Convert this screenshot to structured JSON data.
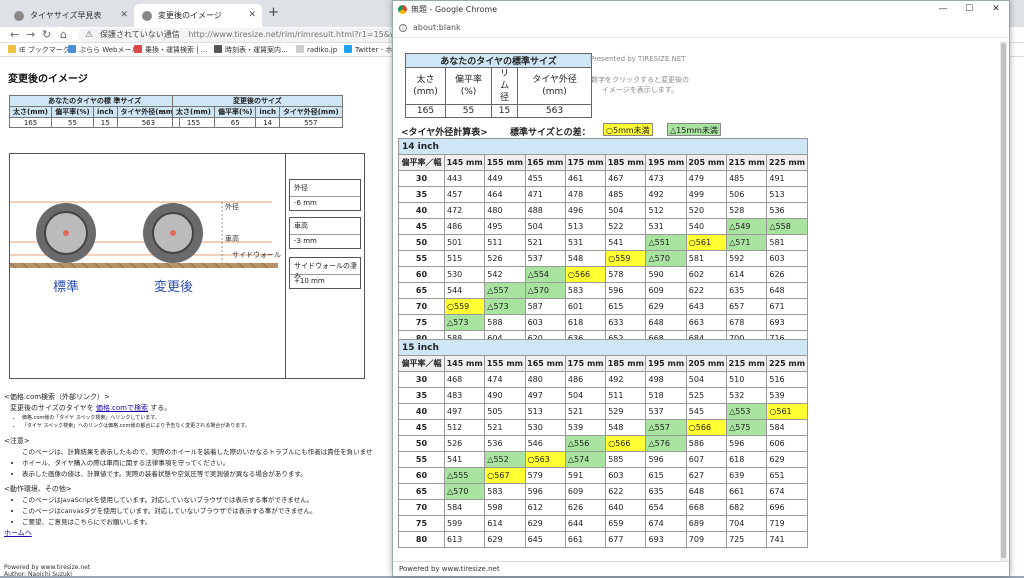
{
  "bg": {
    "tabs": [
      {
        "label": "タイヤサイズ早見表"
      },
      {
        "label": "変更後のイメージ"
      }
    ],
    "security_warning": "保護されていない通信",
    "url": "http://www.tiresize.net/rim/rimresult.html?r1=15&w1=165&f1=558",
    "bookmarks": [
      "IE ブックマーク",
      "ぷらら Webメール",
      "乗換・運賃検索 | ...",
      "時刻表・運賃案内...",
      "radiko.jp",
      "Twitter - ホーム"
    ],
    "page_title": "変更後のイメージ",
    "std_caption": "あなたのタイヤの標 準サイズ",
    "chg_caption": "変更後のサイズ",
    "small_headers": [
      "太さ(mm)",
      "偏平率(%)",
      "inch",
      "タイヤ外径(mm)"
    ],
    "std_values": [
      "165",
      "55",
      "15",
      "563"
    ],
    "chg_values": [
      "155",
      "65",
      "14",
      "557"
    ],
    "arrow": "⇒",
    "diagram": {
      "outer_label": "外径",
      "height_label": "車高",
      "sidewall_label": "サイドウォール",
      "std_name": "標準",
      "chg_name": "変更後",
      "boxes": [
        {
          "k": "外径",
          "v": "-6 mm"
        },
        {
          "k": "車高",
          "v": "-3 mm"
        },
        {
          "k": "サイドウォールの凄み",
          "v": "+10 mm"
        }
      ]
    },
    "kakaku_head": "<価格.com検索（外部リンク）>",
    "kakaku_line_pre": "変更後のサイズのタイヤを",
    "kakaku_link": "価格.comで検索",
    "kakaku_line_post": "する。",
    "kakaku_notes": [
      "価格.com様の「タイヤ スペック検索」へリンクしています。",
      "「タイヤ スペック検索」へのリンクは価格.com様の都合により予告なく変更される場合があります。"
    ],
    "caution_head": "<注意>",
    "caution_items": [
      "このページは、計算結果を表示したもので、実際のホイールを装着した際のいかなるトラブルにも作者は責任を負いませ",
      "ホイール、タイヤ購入の際は車両に関する法律事項を守ってください。",
      "表示した画像の値は、計算値です。実際の装着状態や空気圧等で実測値が異なる場合があります。"
    ],
    "env_head": "<動作環境、その他>",
    "env_items": [
      "このページはJavaScriptを使用しています。対応していないブラウザでは表示する事ができません。",
      "このページはcanvasタグを使用しています。対応していないブラウザでは表示する事ができません。",
      "ご要望、ご意見はこちらにでお願いします。"
    ],
    "home_link": "ホームへ",
    "powered": "Powered by www.tiresize.net",
    "author": "Author: Naoichi Suzuki"
  },
  "popup": {
    "title": "無題 - Google Chrome",
    "address": "about:blank",
    "std_caption": "あなたのタイヤの標準サイズ",
    "std_headers": [
      "太さ(mm)",
      "偏平率(%)",
      "リム径",
      "タイヤ外径(mm)"
    ],
    "std_values": [
      "165",
      "55",
      "15",
      "563"
    ],
    "presented": "Presented by TIRESIZE.NET",
    "hint": "数字をクリックすると変更後のイメージを表示します。",
    "calc_label": "<タイヤ外径計算表>",
    "diff_label": "標準サイズとの差：",
    "legend_5": "○5mm未満",
    "legend_15": "△15mm未満",
    "corner": "偏平率／幅",
    "widths": [
      "145 mm",
      "155 mm",
      "165 mm",
      "175 mm",
      "185 mm",
      "195 mm",
      "205 mm",
      "215 mm",
      "225 mm"
    ],
    "ratios": [
      "30",
      "35",
      "40",
      "45",
      "50",
      "55",
      "60",
      "65",
      "70",
      "75",
      "80"
    ],
    "sections": [
      {
        "title": "14 inch",
        "rows": [
          [
            "443",
            "449",
            "455",
            "461",
            "467",
            "473",
            "479",
            "485",
            "491"
          ],
          [
            "457",
            "464",
            "471",
            "478",
            "485",
            "492",
            "499",
            "506",
            "513"
          ],
          [
            "472",
            "480",
            "488",
            "496",
            "504",
            "512",
            "520",
            "528",
            "536"
          ],
          [
            "486",
            "495",
            "504",
            "513",
            "522",
            "531",
            "540",
            "△549",
            "△558"
          ],
          [
            "501",
            "511",
            "521",
            "531",
            "541",
            "△551",
            "○561",
            "△571",
            "581"
          ],
          [
            "515",
            "526",
            "537",
            "548",
            "○559",
            "△570",
            "581",
            "592",
            "603"
          ],
          [
            "530",
            "542",
            "△554",
            "○566",
            "578",
            "590",
            "602",
            "614",
            "626"
          ],
          [
            "544",
            "△557",
            "△570",
            "583",
            "596",
            "609",
            "622",
            "635",
            "648"
          ],
          [
            "○559",
            "△573",
            "587",
            "601",
            "615",
            "629",
            "643",
            "657",
            "671"
          ],
          [
            "△573",
            "588",
            "603",
            "618",
            "633",
            "648",
            "663",
            "678",
            "693"
          ],
          [
            "588",
            "604",
            "620",
            "636",
            "652",
            "668",
            "684",
            "700",
            "716"
          ]
        ]
      },
      {
        "title": "15 inch",
        "rows": [
          [
            "468",
            "474",
            "480",
            "486",
            "492",
            "498",
            "504",
            "510",
            "516"
          ],
          [
            "483",
            "490",
            "497",
            "504",
            "511",
            "518",
            "525",
            "532",
            "539"
          ],
          [
            "497",
            "505",
            "513",
            "521",
            "529",
            "537",
            "545",
            "△553",
            "○561"
          ],
          [
            "512",
            "521",
            "530",
            "539",
            "548",
            "△557",
            "○566",
            "△575",
            "584"
          ],
          [
            "526",
            "536",
            "546",
            "△556",
            "○566",
            "△576",
            "586",
            "596",
            "606"
          ],
          [
            "541",
            "△552",
            "○563",
            "△574",
            "585",
            "596",
            "607",
            "618",
            "629"
          ],
          [
            "△555",
            "○567",
            "579",
            "591",
            "603",
            "615",
            "627",
            "639",
            "651"
          ],
          [
            "△570",
            "583",
            "596",
            "609",
            "622",
            "635",
            "648",
            "661",
            "674"
          ],
          [
            "584",
            "598",
            "612",
            "626",
            "640",
            "654",
            "668",
            "682",
            "696"
          ],
          [
            "599",
            "614",
            "629",
            "644",
            "659",
            "674",
            "689",
            "704",
            "719"
          ],
          [
            "613",
            "629",
            "645",
            "661",
            "677",
            "693",
            "709",
            "725",
            "741"
          ]
        ]
      }
    ],
    "footer": "Powered by www.tiresize.net",
    "colors": {
      "near": "#ffff33",
      "mid": "#a8e4a0",
      "header": "#cfe6f5"
    }
  }
}
